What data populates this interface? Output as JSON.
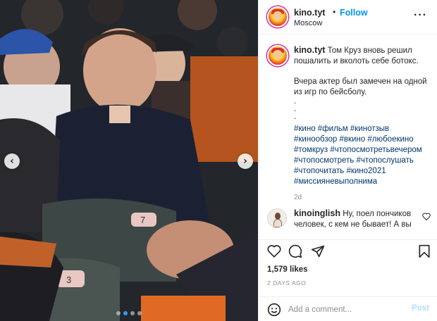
{
  "post": {
    "username": "kino.tyt",
    "follow_label": "Follow",
    "separator": "•",
    "location": "Moscow",
    "more_icon": "more-options-icon"
  },
  "caption": {
    "text_line1": "Том Круз вновь решил пошалить и вколоть себе ботокс.",
    "text_line2": "Вчера актер был замечен на одной из игр по бейсболу.",
    "dot1": ".",
    "dot2": ".",
    "dot3": ".",
    "hashtags": [
      "#кино #фильм #кинотзыв",
      "#кинообзор #вкино #любоекино",
      "#томкруз #чтопосмотретьвечером",
      "#чтопосмотреть #чтопослушать",
      "#чтопочитать #кино2021",
      "#миссияневыполнима"
    ],
    "time_ago": "2d"
  },
  "comments": [
    {
      "username": "kinoinglish",
      "text": "Ну, поел пончиков человек, с кем не бывает! А вы"
    }
  ],
  "actions": {
    "likes": "1,579 likes",
    "date": "2 DAYS AGO",
    "icons": [
      "heart-icon",
      "comment-icon",
      "share-icon",
      "bookmark-icon"
    ]
  },
  "add_comment": {
    "placeholder": "Add a comment...",
    "post_label": "Post"
  },
  "carousel": {
    "slides": 4,
    "active_slide": 1
  },
  "colors": {
    "accent": "#0095f6",
    "hashtag": "#00376b",
    "muted": "#8e8e8e",
    "post_disabled": "#b2dffc"
  }
}
